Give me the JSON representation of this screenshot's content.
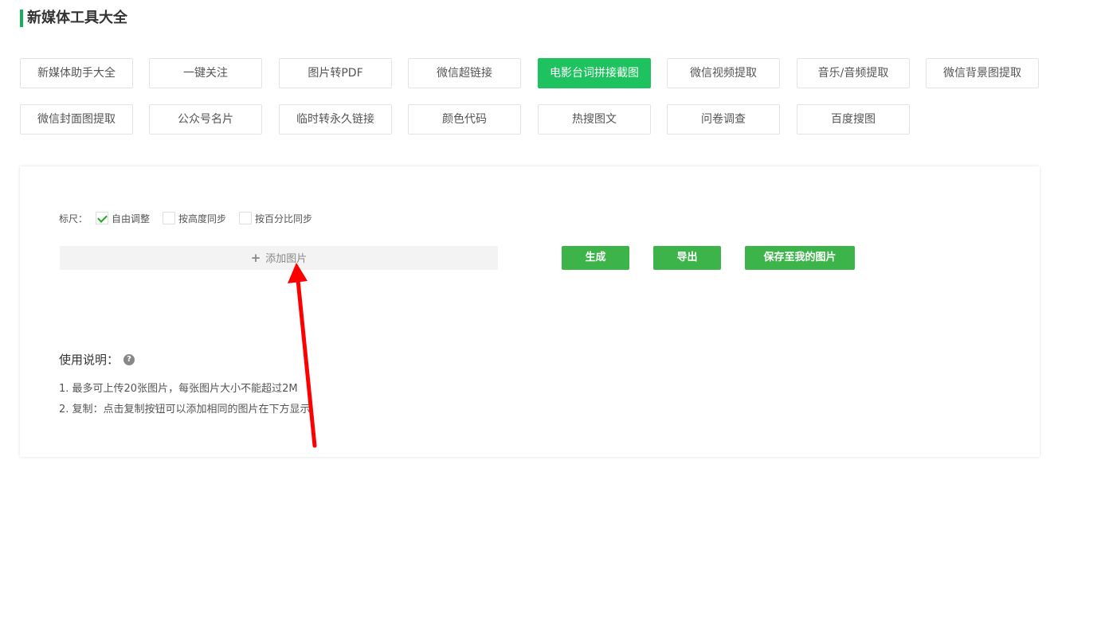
{
  "title": "新媒体工具大全",
  "tools": [
    {
      "label": "新媒体助手大全",
      "active": false
    },
    {
      "label": "一键关注",
      "active": false
    },
    {
      "label": "图片转PDF",
      "active": false
    },
    {
      "label": "微信超链接",
      "active": false
    },
    {
      "label": "电影台词拼接截图",
      "active": true
    },
    {
      "label": "微信视频提取",
      "active": false
    },
    {
      "label": "音乐/音频提取",
      "active": false
    },
    {
      "label": "微信背景图提取",
      "active": false
    },
    {
      "label": "微信封面图提取",
      "active": false
    },
    {
      "label": "公众号名片",
      "active": false
    },
    {
      "label": "临时转永久链接",
      "active": false
    },
    {
      "label": "颜色代码",
      "active": false
    },
    {
      "label": "热搜图文",
      "active": false
    },
    {
      "label": "问卷调查",
      "active": false
    },
    {
      "label": "百度搜图",
      "active": false
    }
  ],
  "ruler": {
    "label": "标尺：",
    "options": [
      {
        "label": "自由调整",
        "checked": true
      },
      {
        "label": "按高度同步",
        "checked": false
      },
      {
        "label": "按百分比同步",
        "checked": false
      }
    ]
  },
  "add_image": {
    "icon": "plus-icon",
    "label": "添加图片"
  },
  "actions": {
    "generate": "生成",
    "export": "导出",
    "save": "保存至我的图片"
  },
  "usage": {
    "title": "使用说明：",
    "help_icon": "question-circle-icon",
    "lines": [
      "1. 最多可上传20张图片，每张图片大小不能超过2M",
      "2. 复制：点击复制按钮可以添加相同的图片在下方显示"
    ]
  },
  "colors": {
    "accent": "#1ec25e",
    "action_button": "#3cb44a",
    "annotation_arrow": "#ff0000"
  }
}
